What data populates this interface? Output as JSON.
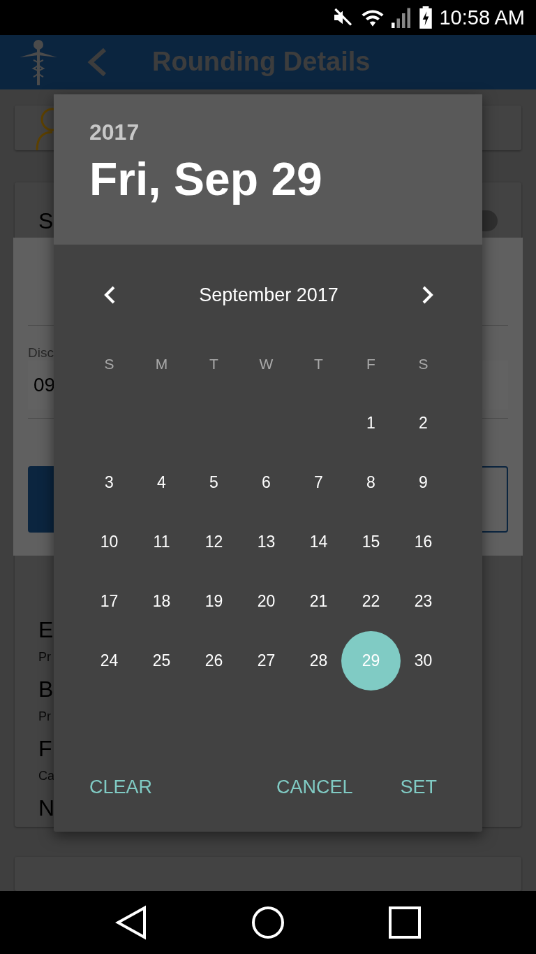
{
  "status_bar": {
    "time": "10:58 AM"
  },
  "app_bar": {
    "title": "Rounding Details"
  },
  "background": {
    "section_letter": "S",
    "toggle": {
      "on": false
    },
    "panel": {
      "field_label": "Disc",
      "field_value": "09"
    },
    "list": [
      {
        "title": "E",
        "subtitle": "Pr"
      },
      {
        "title": "B",
        "subtitle": "Pr"
      },
      {
        "title": "F",
        "subtitle": "Ca"
      },
      {
        "title": "N"
      }
    ]
  },
  "date_picker": {
    "year": "2017",
    "date": "Fri, Sep 29",
    "month": "September 2017",
    "weekdays": [
      "S",
      "M",
      "T",
      "W",
      "T",
      "F",
      "S"
    ],
    "weeks": [
      [
        {
          "day": "1",
          "selected": false
        },
        {
          "day": "2",
          "selected": false
        }
      ],
      [
        {
          "day": "3",
          "selected": false
        },
        {
          "day": "4",
          "selected": false
        },
        {
          "day": "5",
          "selected": false
        },
        {
          "day": "6",
          "selected": false
        },
        {
          "day": "7",
          "selected": false
        },
        {
          "day": "8",
          "selected": false
        },
        {
          "day": "9",
          "selected": false
        }
      ],
      [
        {
          "day": "10",
          "selected": false
        },
        {
          "day": "11",
          "selected": false
        },
        {
          "day": "12",
          "selected": false
        },
        {
          "day": "13",
          "selected": false
        },
        {
          "day": "14",
          "selected": false
        },
        {
          "day": "15",
          "selected": false
        },
        {
          "day": "16",
          "selected": false
        }
      ],
      [
        {
          "day": "17",
          "selected": false
        },
        {
          "day": "18",
          "selected": false
        },
        {
          "day": "19",
          "selected": false
        },
        {
          "day": "20",
          "selected": false
        },
        {
          "day": "21",
          "selected": false
        },
        {
          "day": "22",
          "selected": false
        },
        {
          "day": "23",
          "selected": false
        }
      ],
      [
        {
          "day": "24",
          "selected": false
        },
        {
          "day": "25",
          "selected": false
        },
        {
          "day": "26",
          "selected": false
        },
        {
          "day": "27",
          "selected": false
        },
        {
          "day": "28",
          "selected": false
        },
        {
          "day": "29",
          "selected": true
        },
        {
          "day": "30",
          "selected": false
        }
      ]
    ],
    "buttons": [
      "CLEAR",
      "CANCEL",
      "SET"
    ]
  }
}
